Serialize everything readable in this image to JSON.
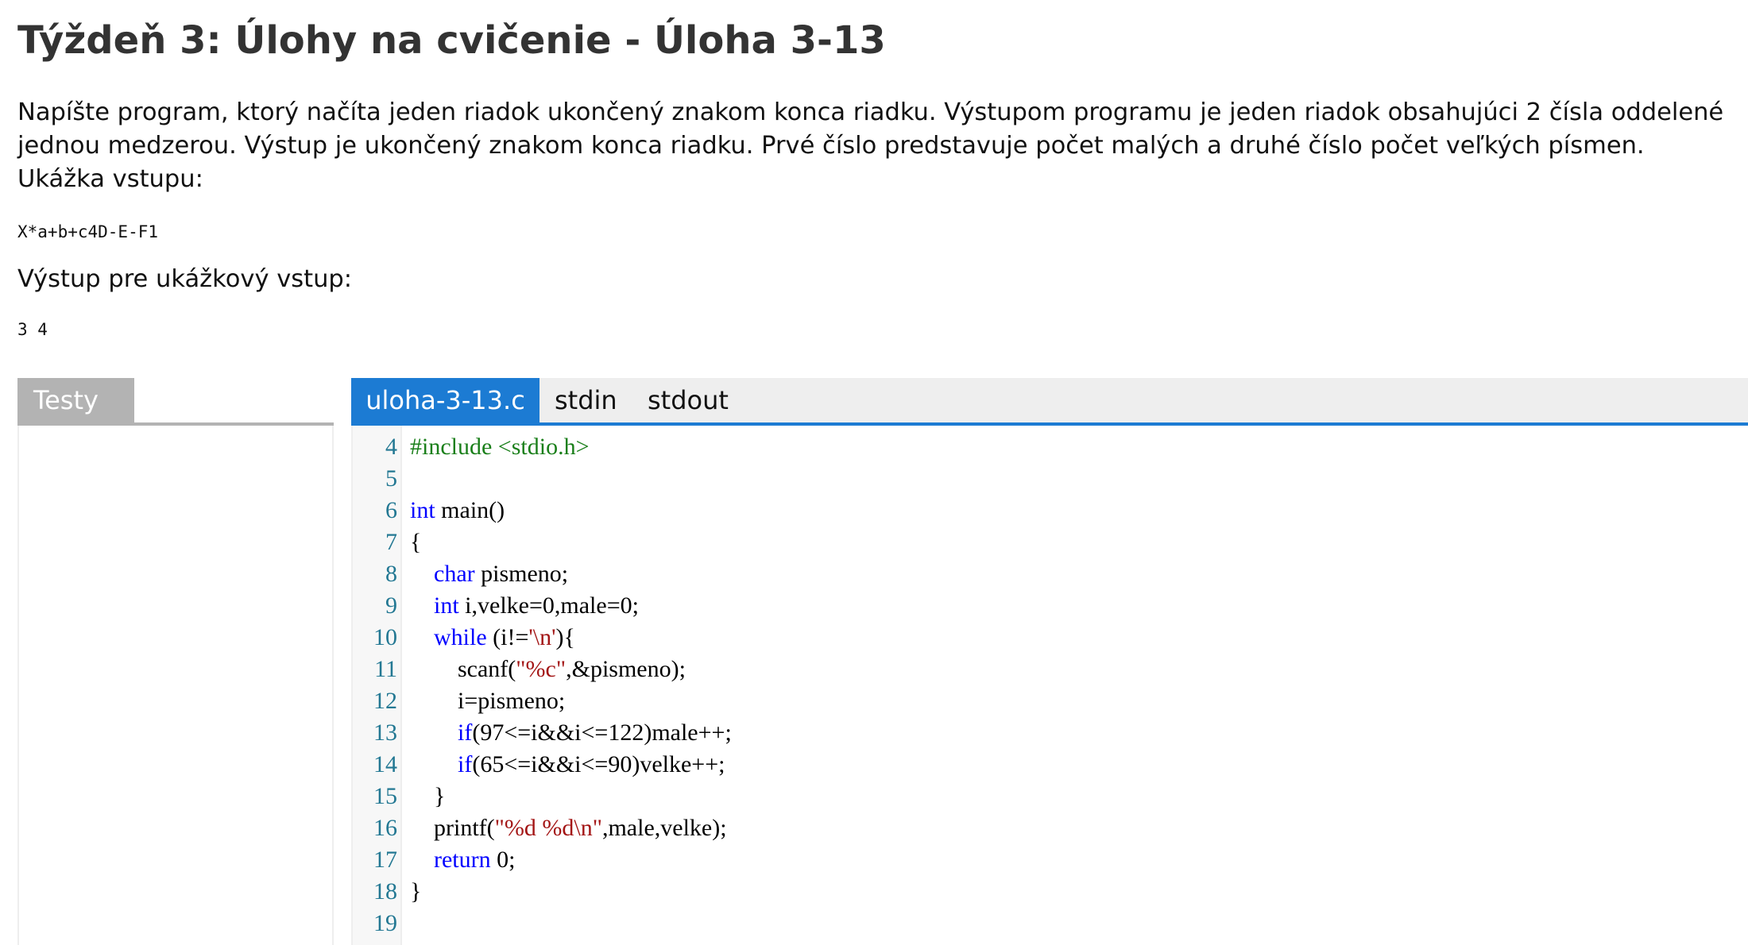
{
  "page": {
    "title": "Týždeň 3: Úlohy na cvičenie - Úloha 3-13",
    "description_lines": [
      "Napíšte program, ktorý načíta jeden riadok ukončený znakom konca riadku. Výstupom programu je jeden riadok obsahujúci 2 čísla oddelené",
      "jednou medzerou. Výstup je ukončený znakom konca riadku. Prvé číslo predstavuje počet malých a druhé číslo počet veľkých písmen.",
      "Ukážka vstupu:"
    ],
    "sample_input": "X*a+b+c4D-E-F1",
    "output_label": "Výstup pre ukážkový vstup:",
    "sample_output": "3 4"
  },
  "tests_panel": {
    "tab_label": "Testy"
  },
  "editor": {
    "tabs": {
      "active": "uloha-3-13.c",
      "stdin": "stdin",
      "stdout": "stdout"
    },
    "lines": [
      {
        "n": "4",
        "tokens": [
          {
            "t": "#include <stdio.h>",
            "c": "directive"
          }
        ]
      },
      {
        "n": "5",
        "tokens": []
      },
      {
        "n": "6",
        "tokens": [
          {
            "t": "int",
            "c": "keyword"
          },
          {
            "t": " main()",
            "c": "plain"
          }
        ]
      },
      {
        "n": "7",
        "tokens": [
          {
            "t": "{",
            "c": "plain"
          }
        ]
      },
      {
        "n": "8",
        "tokens": [
          {
            "t": "    ",
            "c": "plain"
          },
          {
            "t": "char",
            "c": "keyword"
          },
          {
            "t": " pismeno;",
            "c": "plain"
          }
        ]
      },
      {
        "n": "9",
        "tokens": [
          {
            "t": "    ",
            "c": "plain"
          },
          {
            "t": "int",
            "c": "keyword"
          },
          {
            "t": " i,velke=0,male=0;",
            "c": "plain"
          }
        ]
      },
      {
        "n": "10",
        "tokens": [
          {
            "t": "    ",
            "c": "plain"
          },
          {
            "t": "while",
            "c": "keyword"
          },
          {
            "t": " (i!=",
            "c": "plain"
          },
          {
            "t": "'\\n'",
            "c": "string"
          },
          {
            "t": "){",
            "c": "plain"
          }
        ]
      },
      {
        "n": "11",
        "tokens": [
          {
            "t": "        scanf(",
            "c": "plain"
          },
          {
            "t": "\"%c\"",
            "c": "string"
          },
          {
            "t": ",&pismeno);",
            "c": "plain"
          }
        ]
      },
      {
        "n": "12",
        "tokens": [
          {
            "t": "        i=pismeno;",
            "c": "plain"
          }
        ]
      },
      {
        "n": "13",
        "tokens": [
          {
            "t": "        ",
            "c": "plain"
          },
          {
            "t": "if",
            "c": "keyword"
          },
          {
            "t": "(97<=i&&i<=122)male++;",
            "c": "plain"
          }
        ]
      },
      {
        "n": "14",
        "tokens": [
          {
            "t": "        ",
            "c": "plain"
          },
          {
            "t": "if",
            "c": "keyword"
          },
          {
            "t": "(65<=i&&i<=90)velke++;",
            "c": "plain"
          }
        ]
      },
      {
        "n": "15",
        "tokens": [
          {
            "t": "    }",
            "c": "plain"
          }
        ]
      },
      {
        "n": "16",
        "tokens": [
          {
            "t": "    printf(",
            "c": "plain"
          },
          {
            "t": "\"%d %d\\n\"",
            "c": "string"
          },
          {
            "t": ",male,velke);",
            "c": "plain"
          }
        ]
      },
      {
        "n": "17",
        "tokens": [
          {
            "t": "    ",
            "c": "plain"
          },
          {
            "t": "return",
            "c": "keyword"
          },
          {
            "t": " 0;",
            "c": "plain"
          }
        ]
      },
      {
        "n": "18",
        "tokens": [
          {
            "t": "}",
            "c": "plain"
          }
        ]
      },
      {
        "n": "19",
        "tokens": []
      }
    ]
  },
  "colors": {
    "accent": "#1c7bd3",
    "tests_tab": "#b3b3b3",
    "line_number": "#237893",
    "keyword": "#0000ff",
    "directive": "#1a7f1a",
    "string": "#a31515"
  }
}
